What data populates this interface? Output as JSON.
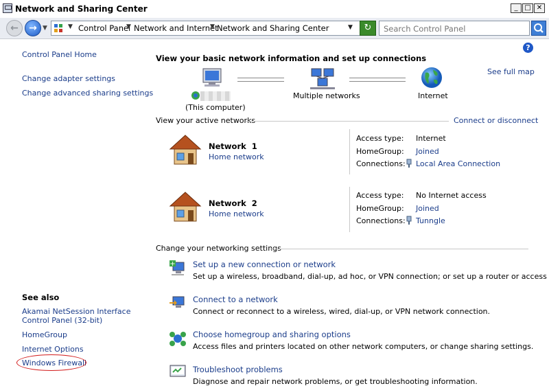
{
  "window": {
    "title": "Network and Sharing Center",
    "min": "_",
    "max": "□",
    "close": "✕"
  },
  "address": {
    "crumbs": [
      "Control Panel",
      "Network and Internet",
      "Network and Sharing Center"
    ],
    "search_placeholder": "Search Control Panel"
  },
  "left": {
    "home": "Control Panel Home",
    "links": [
      "Change adapter settings",
      "Change advanced sharing settings"
    ],
    "see_also_title": "See also",
    "see_also": [
      "Akamai NetSession Interface",
      "Control Panel (32-bit)",
      "HomeGroup",
      "Internet Options",
      "Windows Firewall"
    ]
  },
  "main": {
    "heading": "View your basic network information and set up connections",
    "see_full_map": "See full map",
    "map": {
      "this_computer": "(This computer)",
      "multiple": "Multiple networks",
      "internet": "Internet"
    },
    "active_title": "View your active networks",
    "connect_disconnect": "Connect or disconnect",
    "networks": [
      {
        "name": "Network  1",
        "type": "Home network",
        "access_label": "Access type:",
        "access": "Internet",
        "homegroup_label": "HomeGroup:",
        "homegroup": "Joined",
        "connections_label": "Connections:",
        "connection": "Local Area Connection"
      },
      {
        "name": "Network  2",
        "type": "Home network",
        "access_label": "Access type:",
        "access": "No Internet access",
        "homegroup_label": "HomeGroup:",
        "homegroup": "Joined",
        "connections_label": "Connections:",
        "connection": "Tunngle"
      }
    ],
    "settings_title": "Change your networking settings",
    "tasks": [
      {
        "title": "Set up a new connection or network",
        "desc": "Set up a wireless, broadband, dial-up, ad hoc, or VPN connection; or set up a router or access point."
      },
      {
        "title": "Connect to a network",
        "desc": "Connect or reconnect to a wireless, wired, dial-up, or VPN network connection."
      },
      {
        "title": "Choose homegroup and sharing options",
        "desc": "Access files and printers located on other network computers, or change sharing settings."
      },
      {
        "title": "Troubleshoot problems",
        "desc": "Diagnose and repair network problems, or get troubleshooting information."
      }
    ]
  }
}
